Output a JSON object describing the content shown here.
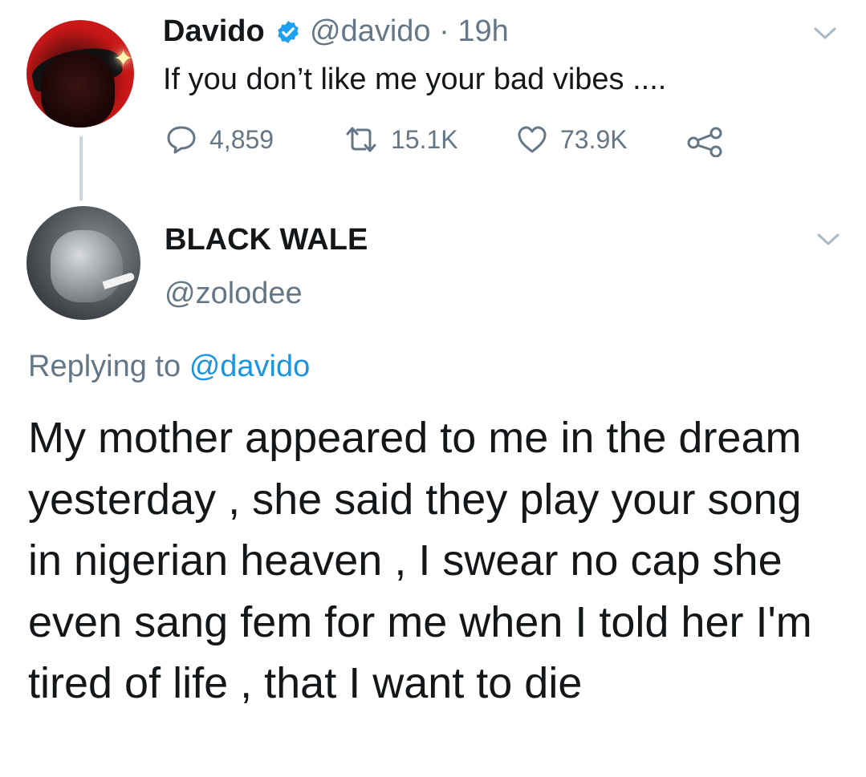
{
  "parent_tweet": {
    "author_name": "Davido",
    "verified": true,
    "handle": "@davido",
    "separator": "·",
    "time": "19h",
    "text": "If you don’t like me your bad vibes ....",
    "actions": {
      "replies": "4,859",
      "retweets": "15.1K",
      "likes": "73.9K"
    }
  },
  "reply_tweet": {
    "author_name": "BLACK WALE",
    "handle": "@zolodee",
    "replying_prefix": "Replying to",
    "replying_to": "@davido",
    "text": "My mother appeared to me in the dream yesterday , she said they play your song in nigerian heaven , I swear no cap she even sang fem for me when I told her I'm tired of life , that I want to die"
  },
  "colors": {
    "text_primary": "#14171a",
    "text_secondary": "#657786",
    "link": "#1b95e0",
    "verified_badge": "#1da1f2",
    "thread_line": "#ccd6dd",
    "chevron": "#aab8c2"
  }
}
